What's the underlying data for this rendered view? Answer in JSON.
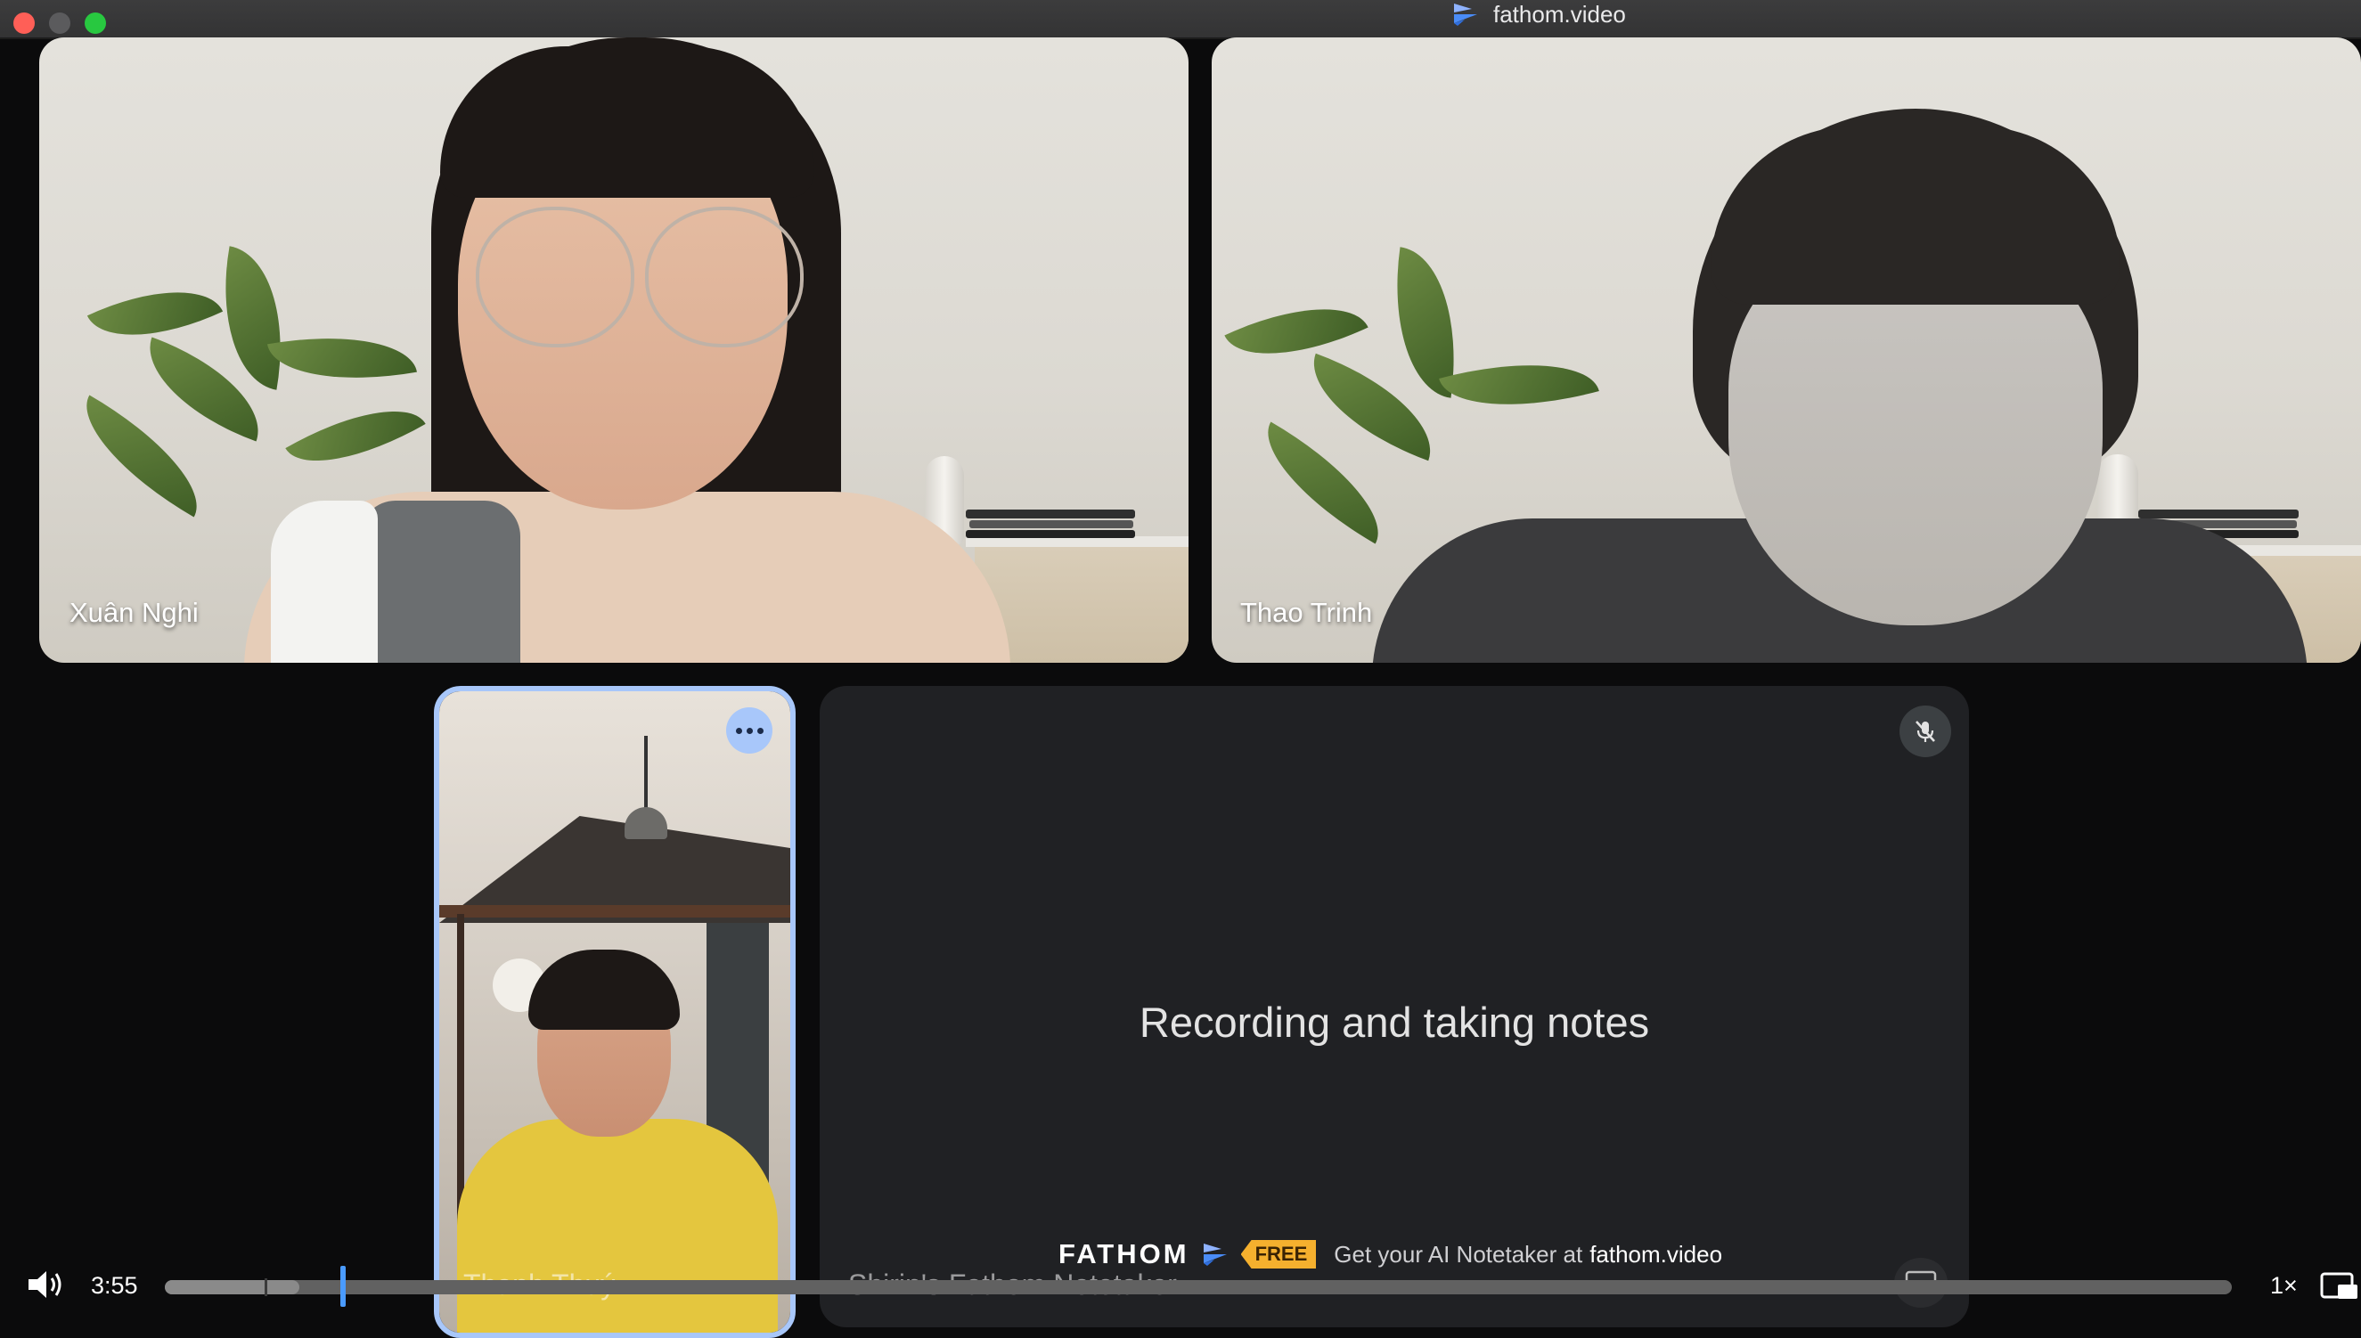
{
  "window": {
    "title": "fathom.video"
  },
  "tiles": [
    {
      "name": "Xuân Nghi"
    },
    {
      "name": "Thao Trinh"
    },
    {
      "name": "Thanh Thuý"
    },
    {
      "name": "Shirin's Fathom Notetaker"
    }
  ],
  "notetaker": {
    "status": "Recording and taking notes"
  },
  "promo": {
    "brand": "FATHOM",
    "badge": "FREE",
    "text": "Get your AI Notetaker at",
    "link": "fathom.video"
  },
  "player": {
    "time": "3:55",
    "speed": "1×",
    "progress_percent": 8.6,
    "buffered_percent": 6.5
  },
  "colors": {
    "active_speaker_border": "#a8c7fa",
    "seek_handle": "#4a9bff",
    "free_badge": "#f5b02e",
    "tile_background": "#202124"
  }
}
